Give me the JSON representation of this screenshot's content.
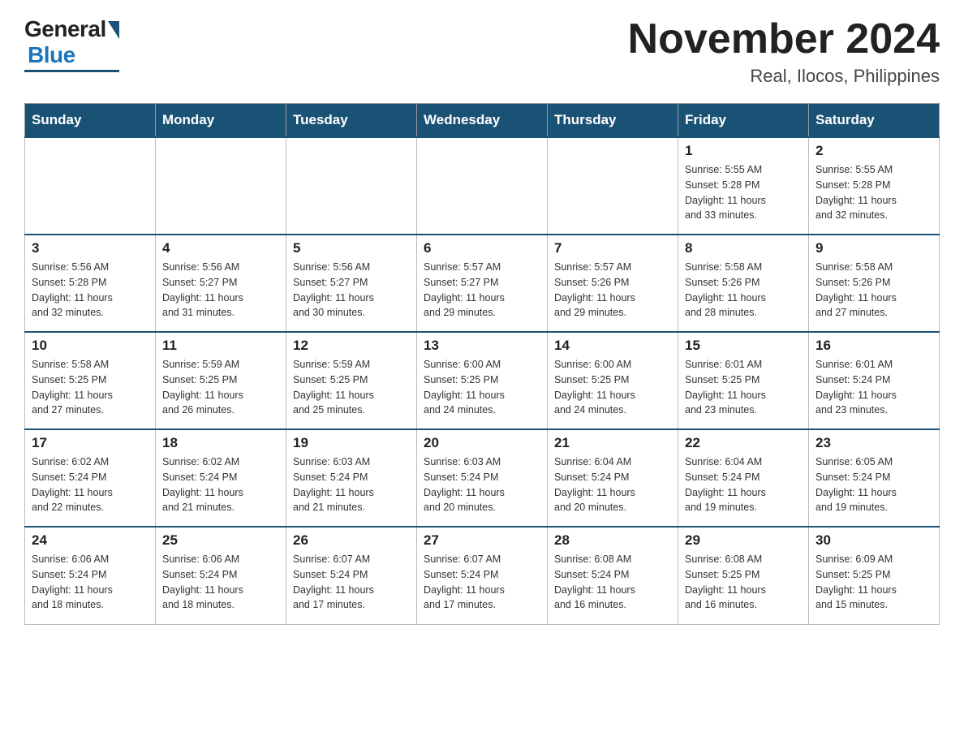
{
  "logo": {
    "general": "General",
    "blue": "Blue"
  },
  "title": "November 2024",
  "subtitle": "Real, Ilocos, Philippines",
  "days_of_week": [
    "Sunday",
    "Monday",
    "Tuesday",
    "Wednesday",
    "Thursday",
    "Friday",
    "Saturday"
  ],
  "weeks": [
    [
      {
        "day": "",
        "info": ""
      },
      {
        "day": "",
        "info": ""
      },
      {
        "day": "",
        "info": ""
      },
      {
        "day": "",
        "info": ""
      },
      {
        "day": "",
        "info": ""
      },
      {
        "day": "1",
        "info": "Sunrise: 5:55 AM\nSunset: 5:28 PM\nDaylight: 11 hours\nand 33 minutes."
      },
      {
        "day": "2",
        "info": "Sunrise: 5:55 AM\nSunset: 5:28 PM\nDaylight: 11 hours\nand 32 minutes."
      }
    ],
    [
      {
        "day": "3",
        "info": "Sunrise: 5:56 AM\nSunset: 5:28 PM\nDaylight: 11 hours\nand 32 minutes."
      },
      {
        "day": "4",
        "info": "Sunrise: 5:56 AM\nSunset: 5:27 PM\nDaylight: 11 hours\nand 31 minutes."
      },
      {
        "day": "5",
        "info": "Sunrise: 5:56 AM\nSunset: 5:27 PM\nDaylight: 11 hours\nand 30 minutes."
      },
      {
        "day": "6",
        "info": "Sunrise: 5:57 AM\nSunset: 5:27 PM\nDaylight: 11 hours\nand 29 minutes."
      },
      {
        "day": "7",
        "info": "Sunrise: 5:57 AM\nSunset: 5:26 PM\nDaylight: 11 hours\nand 29 minutes."
      },
      {
        "day": "8",
        "info": "Sunrise: 5:58 AM\nSunset: 5:26 PM\nDaylight: 11 hours\nand 28 minutes."
      },
      {
        "day": "9",
        "info": "Sunrise: 5:58 AM\nSunset: 5:26 PM\nDaylight: 11 hours\nand 27 minutes."
      }
    ],
    [
      {
        "day": "10",
        "info": "Sunrise: 5:58 AM\nSunset: 5:25 PM\nDaylight: 11 hours\nand 27 minutes."
      },
      {
        "day": "11",
        "info": "Sunrise: 5:59 AM\nSunset: 5:25 PM\nDaylight: 11 hours\nand 26 minutes."
      },
      {
        "day": "12",
        "info": "Sunrise: 5:59 AM\nSunset: 5:25 PM\nDaylight: 11 hours\nand 25 minutes."
      },
      {
        "day": "13",
        "info": "Sunrise: 6:00 AM\nSunset: 5:25 PM\nDaylight: 11 hours\nand 24 minutes."
      },
      {
        "day": "14",
        "info": "Sunrise: 6:00 AM\nSunset: 5:25 PM\nDaylight: 11 hours\nand 24 minutes."
      },
      {
        "day": "15",
        "info": "Sunrise: 6:01 AM\nSunset: 5:25 PM\nDaylight: 11 hours\nand 23 minutes."
      },
      {
        "day": "16",
        "info": "Sunrise: 6:01 AM\nSunset: 5:24 PM\nDaylight: 11 hours\nand 23 minutes."
      }
    ],
    [
      {
        "day": "17",
        "info": "Sunrise: 6:02 AM\nSunset: 5:24 PM\nDaylight: 11 hours\nand 22 minutes."
      },
      {
        "day": "18",
        "info": "Sunrise: 6:02 AM\nSunset: 5:24 PM\nDaylight: 11 hours\nand 21 minutes."
      },
      {
        "day": "19",
        "info": "Sunrise: 6:03 AM\nSunset: 5:24 PM\nDaylight: 11 hours\nand 21 minutes."
      },
      {
        "day": "20",
        "info": "Sunrise: 6:03 AM\nSunset: 5:24 PM\nDaylight: 11 hours\nand 20 minutes."
      },
      {
        "day": "21",
        "info": "Sunrise: 6:04 AM\nSunset: 5:24 PM\nDaylight: 11 hours\nand 20 minutes."
      },
      {
        "day": "22",
        "info": "Sunrise: 6:04 AM\nSunset: 5:24 PM\nDaylight: 11 hours\nand 19 minutes."
      },
      {
        "day": "23",
        "info": "Sunrise: 6:05 AM\nSunset: 5:24 PM\nDaylight: 11 hours\nand 19 minutes."
      }
    ],
    [
      {
        "day": "24",
        "info": "Sunrise: 6:06 AM\nSunset: 5:24 PM\nDaylight: 11 hours\nand 18 minutes."
      },
      {
        "day": "25",
        "info": "Sunrise: 6:06 AM\nSunset: 5:24 PM\nDaylight: 11 hours\nand 18 minutes."
      },
      {
        "day": "26",
        "info": "Sunrise: 6:07 AM\nSunset: 5:24 PM\nDaylight: 11 hours\nand 17 minutes."
      },
      {
        "day": "27",
        "info": "Sunrise: 6:07 AM\nSunset: 5:24 PM\nDaylight: 11 hours\nand 17 minutes."
      },
      {
        "day": "28",
        "info": "Sunrise: 6:08 AM\nSunset: 5:24 PM\nDaylight: 11 hours\nand 16 minutes."
      },
      {
        "day": "29",
        "info": "Sunrise: 6:08 AM\nSunset: 5:25 PM\nDaylight: 11 hours\nand 16 minutes."
      },
      {
        "day": "30",
        "info": "Sunrise: 6:09 AM\nSunset: 5:25 PM\nDaylight: 11 hours\nand 15 minutes."
      }
    ]
  ]
}
